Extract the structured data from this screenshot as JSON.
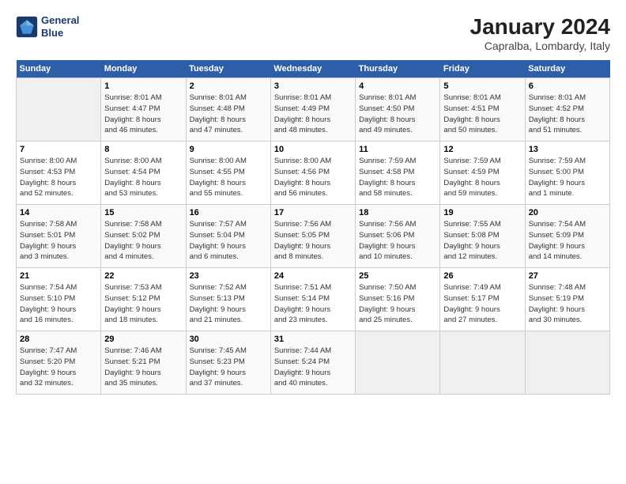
{
  "logo": {
    "line1": "General",
    "line2": "Blue"
  },
  "title": "January 2024",
  "subtitle": "Capralba, Lombardy, Italy",
  "days_of_week": [
    "Sunday",
    "Monday",
    "Tuesday",
    "Wednesday",
    "Thursday",
    "Friday",
    "Saturday"
  ],
  "weeks": [
    [
      {
        "num": "",
        "info": ""
      },
      {
        "num": "1",
        "info": "Sunrise: 8:01 AM\nSunset: 4:47 PM\nDaylight: 8 hours\nand 46 minutes."
      },
      {
        "num": "2",
        "info": "Sunrise: 8:01 AM\nSunset: 4:48 PM\nDaylight: 8 hours\nand 47 minutes."
      },
      {
        "num": "3",
        "info": "Sunrise: 8:01 AM\nSunset: 4:49 PM\nDaylight: 8 hours\nand 48 minutes."
      },
      {
        "num": "4",
        "info": "Sunrise: 8:01 AM\nSunset: 4:50 PM\nDaylight: 8 hours\nand 49 minutes."
      },
      {
        "num": "5",
        "info": "Sunrise: 8:01 AM\nSunset: 4:51 PM\nDaylight: 8 hours\nand 50 minutes."
      },
      {
        "num": "6",
        "info": "Sunrise: 8:01 AM\nSunset: 4:52 PM\nDaylight: 8 hours\nand 51 minutes."
      }
    ],
    [
      {
        "num": "7",
        "info": "Sunrise: 8:00 AM\nSunset: 4:53 PM\nDaylight: 8 hours\nand 52 minutes."
      },
      {
        "num": "8",
        "info": "Sunrise: 8:00 AM\nSunset: 4:54 PM\nDaylight: 8 hours\nand 53 minutes."
      },
      {
        "num": "9",
        "info": "Sunrise: 8:00 AM\nSunset: 4:55 PM\nDaylight: 8 hours\nand 55 minutes."
      },
      {
        "num": "10",
        "info": "Sunrise: 8:00 AM\nSunset: 4:56 PM\nDaylight: 8 hours\nand 56 minutes."
      },
      {
        "num": "11",
        "info": "Sunrise: 7:59 AM\nSunset: 4:58 PM\nDaylight: 8 hours\nand 58 minutes."
      },
      {
        "num": "12",
        "info": "Sunrise: 7:59 AM\nSunset: 4:59 PM\nDaylight: 8 hours\nand 59 minutes."
      },
      {
        "num": "13",
        "info": "Sunrise: 7:59 AM\nSunset: 5:00 PM\nDaylight: 9 hours\nand 1 minute."
      }
    ],
    [
      {
        "num": "14",
        "info": "Sunrise: 7:58 AM\nSunset: 5:01 PM\nDaylight: 9 hours\nand 3 minutes."
      },
      {
        "num": "15",
        "info": "Sunrise: 7:58 AM\nSunset: 5:02 PM\nDaylight: 9 hours\nand 4 minutes."
      },
      {
        "num": "16",
        "info": "Sunrise: 7:57 AM\nSunset: 5:04 PM\nDaylight: 9 hours\nand 6 minutes."
      },
      {
        "num": "17",
        "info": "Sunrise: 7:56 AM\nSunset: 5:05 PM\nDaylight: 9 hours\nand 8 minutes."
      },
      {
        "num": "18",
        "info": "Sunrise: 7:56 AM\nSunset: 5:06 PM\nDaylight: 9 hours\nand 10 minutes."
      },
      {
        "num": "19",
        "info": "Sunrise: 7:55 AM\nSunset: 5:08 PM\nDaylight: 9 hours\nand 12 minutes."
      },
      {
        "num": "20",
        "info": "Sunrise: 7:54 AM\nSunset: 5:09 PM\nDaylight: 9 hours\nand 14 minutes."
      }
    ],
    [
      {
        "num": "21",
        "info": "Sunrise: 7:54 AM\nSunset: 5:10 PM\nDaylight: 9 hours\nand 16 minutes."
      },
      {
        "num": "22",
        "info": "Sunrise: 7:53 AM\nSunset: 5:12 PM\nDaylight: 9 hours\nand 18 minutes."
      },
      {
        "num": "23",
        "info": "Sunrise: 7:52 AM\nSunset: 5:13 PM\nDaylight: 9 hours\nand 21 minutes."
      },
      {
        "num": "24",
        "info": "Sunrise: 7:51 AM\nSunset: 5:14 PM\nDaylight: 9 hours\nand 23 minutes."
      },
      {
        "num": "25",
        "info": "Sunrise: 7:50 AM\nSunset: 5:16 PM\nDaylight: 9 hours\nand 25 minutes."
      },
      {
        "num": "26",
        "info": "Sunrise: 7:49 AM\nSunset: 5:17 PM\nDaylight: 9 hours\nand 27 minutes."
      },
      {
        "num": "27",
        "info": "Sunrise: 7:48 AM\nSunset: 5:19 PM\nDaylight: 9 hours\nand 30 minutes."
      }
    ],
    [
      {
        "num": "28",
        "info": "Sunrise: 7:47 AM\nSunset: 5:20 PM\nDaylight: 9 hours\nand 32 minutes."
      },
      {
        "num": "29",
        "info": "Sunrise: 7:46 AM\nSunset: 5:21 PM\nDaylight: 9 hours\nand 35 minutes."
      },
      {
        "num": "30",
        "info": "Sunrise: 7:45 AM\nSunset: 5:23 PM\nDaylight: 9 hours\nand 37 minutes."
      },
      {
        "num": "31",
        "info": "Sunrise: 7:44 AM\nSunset: 5:24 PM\nDaylight: 9 hours\nand 40 minutes."
      },
      {
        "num": "",
        "info": ""
      },
      {
        "num": "",
        "info": ""
      },
      {
        "num": "",
        "info": ""
      }
    ]
  ]
}
